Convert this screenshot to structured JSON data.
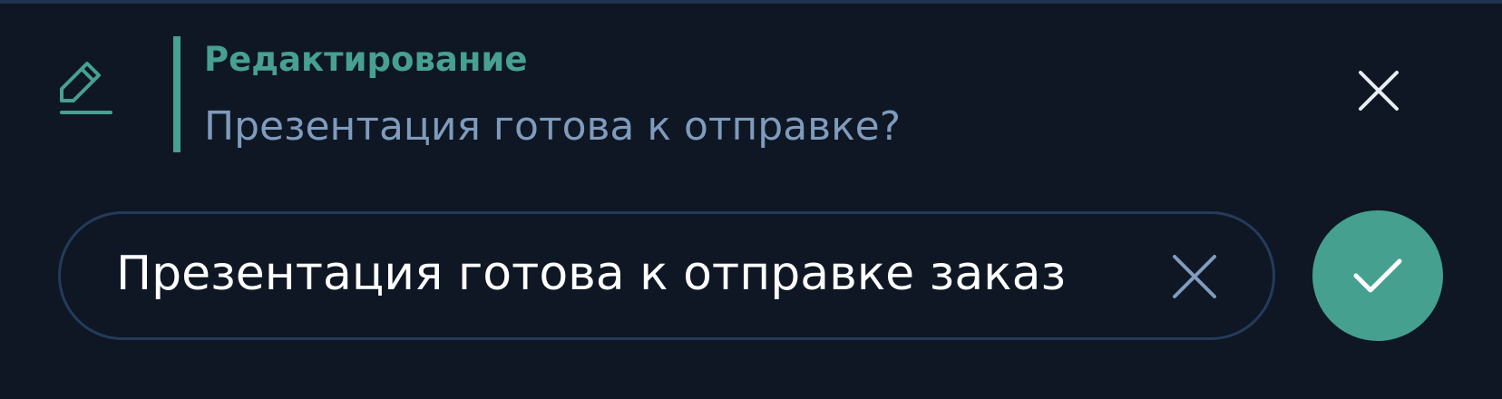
{
  "edit": {
    "icon": "pencil-icon",
    "title": "Редактирование",
    "original_message": "Презентация готова к отправке?"
  },
  "composer": {
    "message_text": "Презентация готова к отправке заказ",
    "clear_icon": "close-icon",
    "confirm_icon": "checkmark-icon"
  },
  "colors": {
    "background": "#0e1723",
    "accent": "#47a091",
    "secondary_text": "#7f9bbd",
    "border": "#243b5b"
  }
}
